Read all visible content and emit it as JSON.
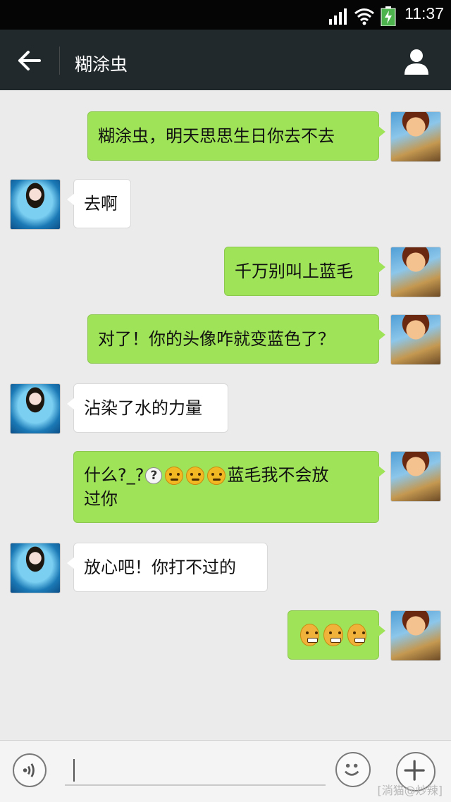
{
  "status": {
    "time": "11:37"
  },
  "header": {
    "title": "糊涂虫"
  },
  "messages": [
    {
      "dir": "out",
      "text": "糊涂虫，明天思思生日你去不去"
    },
    {
      "dir": "in",
      "text": "去啊"
    },
    {
      "dir": "out",
      "text": "千万别叫上蓝毛"
    },
    {
      "dir": "out",
      "text": "对了！你的头像咋就变蓝色了？"
    },
    {
      "dir": "in",
      "text": "沾染了水的力量"
    },
    {
      "dir": "out",
      "text_a": "什么?_?",
      "text_b": "蓝毛我不会放",
      "text_c": "过你"
    },
    {
      "dir": "in",
      "text": "放心吧！你打不过的"
    },
    {
      "dir": "out",
      "emojis": [
        "angry-face",
        "angry-face",
        "angry-face"
      ]
    }
  ],
  "input": {
    "placeholder": ""
  },
  "watermark": "[淌猫@炒辣]",
  "colors": {
    "out_bubble": "#9fe358",
    "in_bubble": "#ffffff",
    "title_bar": "#22292c",
    "background": "#ebebeb"
  }
}
